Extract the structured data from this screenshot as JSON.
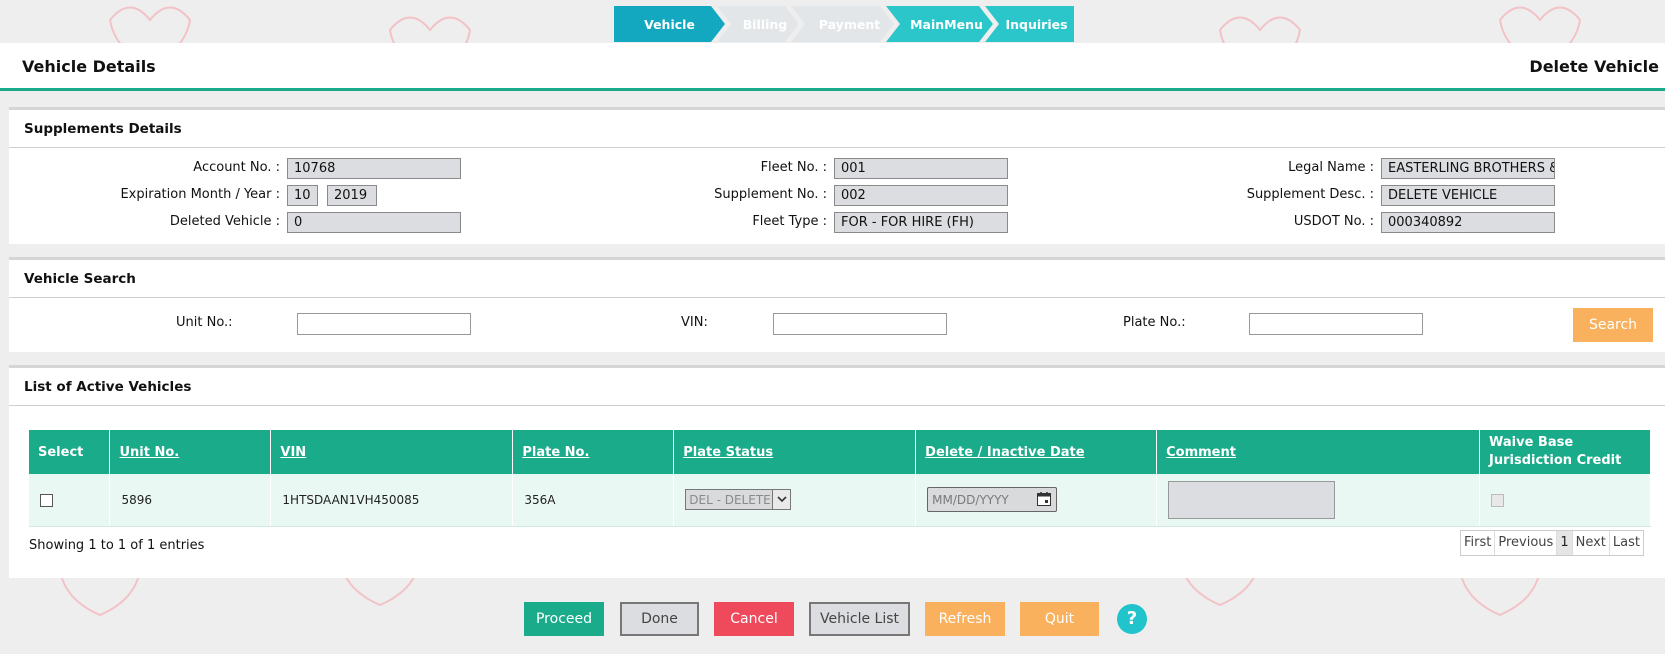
{
  "steps": [
    {
      "label": "Vehicle",
      "state": "active"
    },
    {
      "label": "Billing",
      "state": "disabled"
    },
    {
      "label": "Payment",
      "state": "disabled"
    },
    {
      "label": "MainMenu",
      "state": "done"
    },
    {
      "label": "Inquiries",
      "state": "done"
    }
  ],
  "header": {
    "title": "Vehicle Details",
    "action": "Delete Vehicle"
  },
  "supplements": {
    "heading": "Supplements Details",
    "account_label": "Account No. :",
    "account_value": "10768",
    "expiration_label": "Expiration Month / Year :",
    "exp_month": "10",
    "exp_year": "2019",
    "deleted_label": "Deleted Vehicle :",
    "deleted_value": "0",
    "fleet_label": "Fleet No. :",
    "fleet_value": "001",
    "supplement_label": "Supplement No. :",
    "supplement_value": "002",
    "fleettype_label": "Fleet Type :",
    "fleettype_value": "FOR - FOR HIRE (FH)",
    "legal_label": "Legal Name :",
    "legal_value": "EASTERLING BROTHERS & S",
    "desc_label": "Supplement Desc. :",
    "desc_value": "DELETE VEHICLE",
    "usdot_label": "USDOT No. :",
    "usdot_value": "000340892"
  },
  "search": {
    "heading": "Vehicle Search",
    "unit_label": "Unit No.:",
    "vin_label": "VIN:",
    "plate_label": "Plate No.:",
    "unit_value": "",
    "vin_value": "",
    "plate_value": "",
    "button": "Search"
  },
  "vehicles": {
    "heading": "List of Active Vehicles",
    "columns": [
      "Select",
      "Unit No.",
      "VIN",
      "Plate No.",
      "Plate Status",
      "Delete / Inactive Date",
      "Comment",
      "Waive Base Jurisdiction Credit"
    ],
    "rows": [
      {
        "unit": "5896",
        "vin": "1HTSDAAN1VH450085",
        "plate": "356A",
        "status": "DEL - DELETED",
        "date_placeholder": "MM/DD/YYYY"
      }
    ],
    "showing": "Showing 1 to 1 of 1 entries",
    "pager": [
      "First",
      "Previous",
      "1",
      "Next",
      "Last"
    ]
  },
  "buttons": {
    "proceed": "Proceed",
    "done": "Done",
    "cancel": "Cancel",
    "vehicle_list": "Vehicle List",
    "refresh": "Refresh",
    "quit": "Quit",
    "help": "?"
  },
  "colors": {
    "accent": "#1aab8a",
    "step_active": "#14a8c0",
    "step_done": "#2bc6c9",
    "warn": "#f9b15e",
    "danger": "#ee4a5c"
  }
}
